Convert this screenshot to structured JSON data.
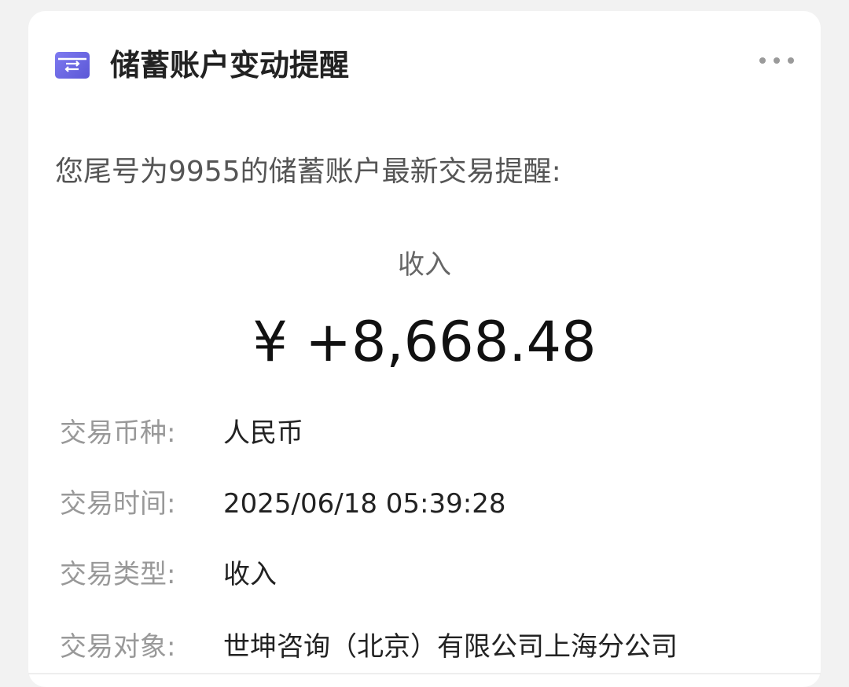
{
  "header": {
    "icon": "transfer-icon",
    "title": "储蓄账户变动提醒",
    "more_icon": "more-icon"
  },
  "message": {
    "intro": "您尾号为9955的储蓄账户最新交易提醒:",
    "type_label": "收入",
    "amount": "¥ +8,668.48"
  },
  "details": [
    {
      "label": "交易币种:",
      "value": "人民币"
    },
    {
      "label": "交易时间:",
      "value": "2025/06/18 05:39:28"
    },
    {
      "label": "交易类型:",
      "value": "收入"
    },
    {
      "label": "交易对象:",
      "value": "世坤咨询（北京）有限公司上海分公司"
    }
  ],
  "colors": {
    "icon_accent": "#6a66e6",
    "background": "#f2f2f2",
    "card": "#ffffff"
  }
}
